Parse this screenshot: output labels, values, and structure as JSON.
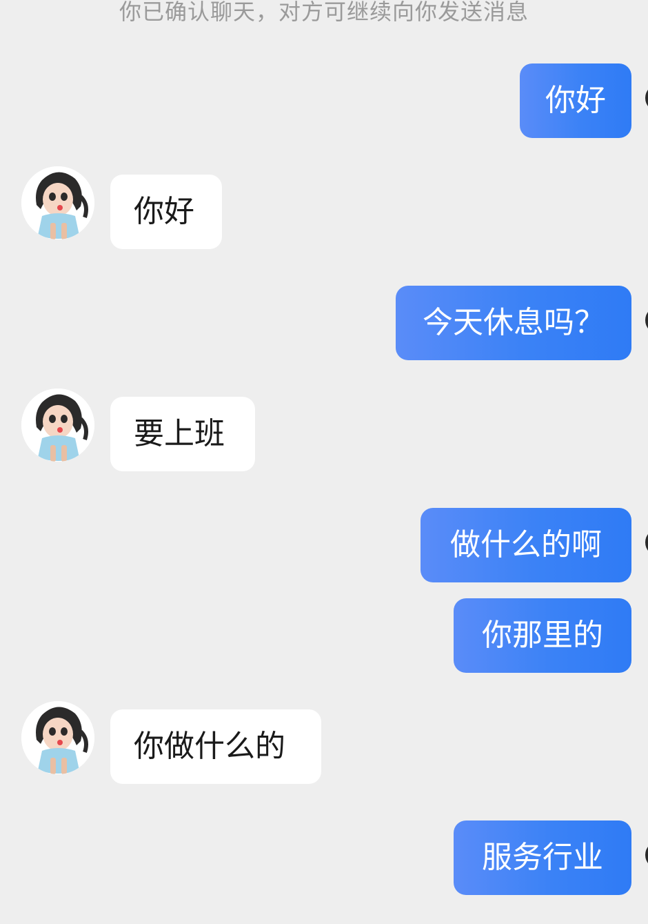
{
  "notice": "你已确认聊天，对方可继续向你发送消息",
  "messages": [
    {
      "from": "me",
      "text": "你好"
    },
    {
      "from": "them",
      "text": "你好"
    },
    {
      "from": "me",
      "text": "今天休息吗？"
    },
    {
      "from": "them",
      "text": "要上班"
    },
    {
      "from": "me",
      "text": "做什么的啊"
    },
    {
      "from": "me",
      "text": "你那里的"
    },
    {
      "from": "them",
      "text": "你做什么的"
    },
    {
      "from": "me",
      "text": "服务行业"
    }
  ],
  "colors": {
    "background": "#eeeeee",
    "sent_bubble": "#3b82f6",
    "received_bubble": "#ffffff",
    "notice_text": "#9a9a9a"
  },
  "icons": {
    "contact_avatar": "cartoon-girl-avatar",
    "my_avatar": "user-avatar"
  }
}
